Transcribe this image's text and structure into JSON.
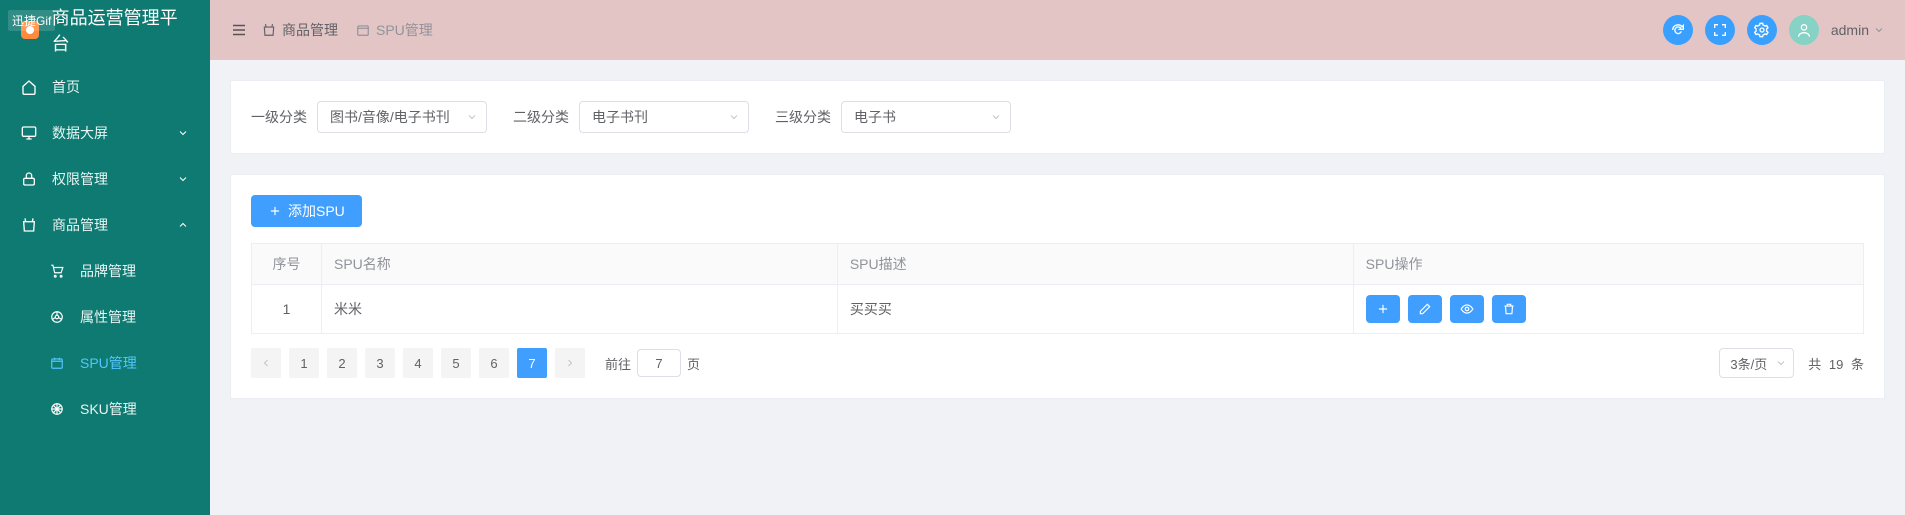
{
  "app": {
    "title": "商品运营管理平台",
    "gif_tag": "迅捷Gif"
  },
  "sidebar": {
    "items": [
      {
        "key": "home",
        "label": "首页",
        "icon": "home-icon",
        "type": "item"
      },
      {
        "key": "dash",
        "label": "数据大屏",
        "icon": "monitor-icon",
        "type": "submenu",
        "open": false
      },
      {
        "key": "auth",
        "label": "权限管理",
        "icon": "lock-icon",
        "type": "submenu",
        "open": false
      },
      {
        "key": "goods",
        "label": "商品管理",
        "icon": "bag-icon",
        "type": "submenu",
        "open": true,
        "children": [
          {
            "key": "brand",
            "label": "品牌管理",
            "icon": "cart-icon"
          },
          {
            "key": "attr",
            "label": "属性管理",
            "icon": "chrome-icon"
          },
          {
            "key": "spu",
            "label": "SPU管理",
            "icon": "calendar-icon",
            "active": true
          },
          {
            "key": "sku",
            "label": "SKU管理",
            "icon": "orange-icon"
          }
        ]
      }
    ]
  },
  "breadcrumbs": [
    {
      "label": "商品管理",
      "icon": "bag-icon"
    },
    {
      "label": "SPU管理",
      "icon": "calendar-icon"
    }
  ],
  "topbar": {
    "username": "admin"
  },
  "filters": {
    "level1": {
      "label": "一级分类",
      "value": "图书/音像/电子书刊"
    },
    "level2": {
      "label": "二级分类",
      "value": "电子书刊"
    },
    "level3": {
      "label": "三级分类",
      "value": "电子书"
    }
  },
  "toolbar": {
    "add_spu_label": "添加SPU"
  },
  "table": {
    "headers": {
      "idx": "序号",
      "name": "SPU名称",
      "desc": "SPU描述",
      "ops": "SPU操作"
    },
    "rows": [
      {
        "idx": "1",
        "name": "米米",
        "desc": "买买买"
      }
    ]
  },
  "pagination": {
    "pages": [
      "1",
      "2",
      "3",
      "4",
      "5",
      "6",
      "7"
    ],
    "current": "7",
    "goto_prefix": "前往",
    "goto_value": "7",
    "goto_suffix": "页",
    "page_size_label": "3条/页",
    "total_prefix": "共",
    "total_count": "19",
    "total_suffix": "条"
  }
}
